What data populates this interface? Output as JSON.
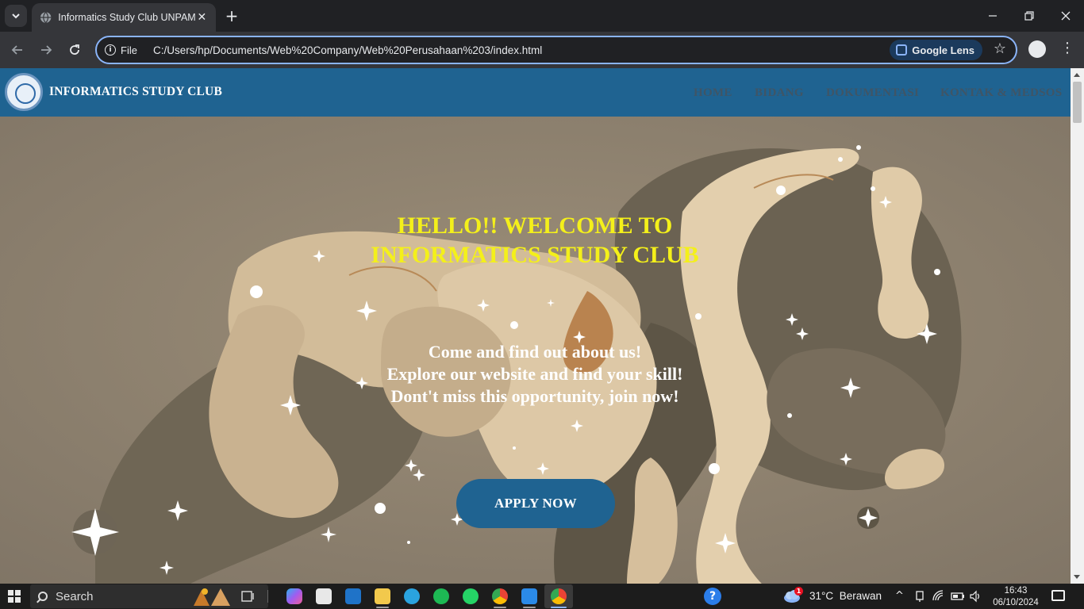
{
  "browser": {
    "tab_title": "Informatics Study Club UNPAM",
    "scheme_label": "File",
    "url": "C:/Users/hp/Documents/Web%20Company/Web%20Perusahaan%203/index.html",
    "lens_label": "Google Lens",
    "new_tab": "+",
    "tab_close": "✕"
  },
  "site": {
    "brand": "INFORMATICS STUDY CLUB",
    "menu": [
      "HOME",
      "BIDANG",
      "DOKUMENTASI",
      "KONTAK & MEDSOS"
    ],
    "headline_line1": "HELLO!! WELCOME TO",
    "headline_line2": "INFORMATICS STUDY CLUB",
    "tagline_line1": "Come and find out about us!",
    "tagline_line2": "Explore our website and find your skill!",
    "tagline_line3": "Dont't miss this opportunity, join now!",
    "cta_label": "APPLY NOW",
    "colors": {
      "nav": "#1f6391",
      "headline": "#f4f01a",
      "cta": "#1f6391"
    }
  },
  "taskbar": {
    "search_label": "Search",
    "weather_temp": "31°C",
    "weather_desc": "Berawan",
    "weather_badge": "1",
    "time": "16:43",
    "date": "06/10/2024",
    "pinned_icons": [
      "copilot-icon",
      "microsoft-store-icon",
      "outlook-icon",
      "file-explorer-icon",
      "telegram-icon",
      "spotify-icon",
      "whatsapp-icon",
      "chrome-icon",
      "vscode-icon",
      "chrome-active-icon"
    ]
  }
}
